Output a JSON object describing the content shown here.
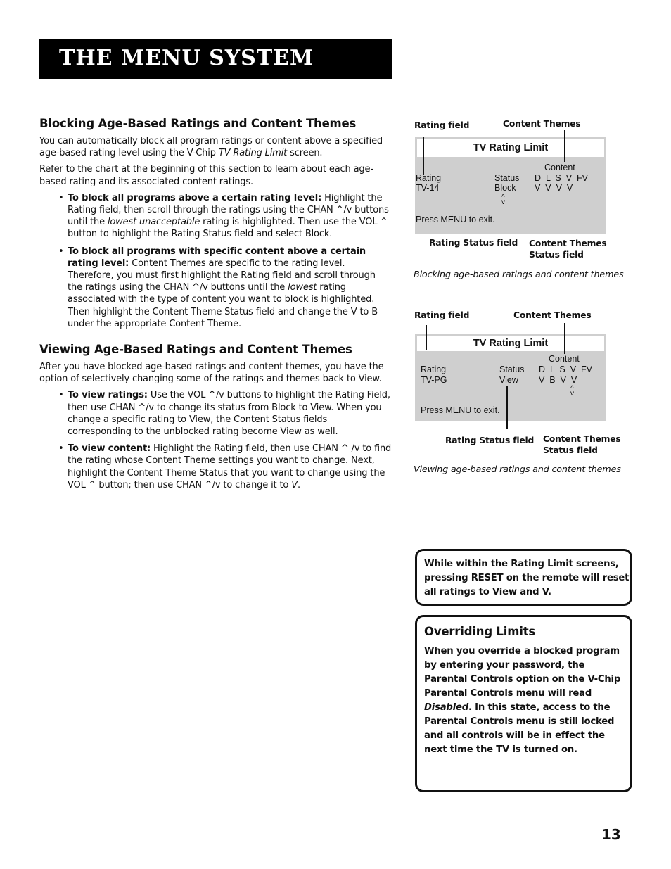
{
  "header": {
    "title": "THE MENU SYSTEM"
  },
  "sections": [
    {
      "heading": "Blocking Age-Based Ratings and Content Themes",
      "paragraphs": [
        {
          "pre": "You can automatically block all program ratings or content above a specified age-based rating level using the V-Chip ",
          "italic": "TV Rating Limit",
          "post": " screen."
        },
        {
          "pre": "Refer to the chart at the beginning of this section to learn about each age-based rating and its associated content ratings.",
          "italic": "",
          "post": ""
        }
      ],
      "bullets": [
        {
          "lead": "To block all programs above a certain rating level:",
          "pre": "   Highlight the Rating field, then scroll through the ratings using the CHAN ^/v buttons until the ",
          "italic": "lowest unacceptable",
          "post": " rating is highlighted. Then use the VOL ^ button to highlight the Rating Status field and select Block."
        },
        {
          "lead": "To block all programs with specific content above a certain rating level:",
          "pre": "   Content Themes are specific to the rating level. Therefore, you must first highlight the Rating field and scroll through the ratings using the CHAN ^/v buttons until the ",
          "italic": "lowest",
          "post": "  rating associated with the type of content you want to block is highlighted. Then highlight the Content Theme Status field and change the V to B under the appropriate Content Theme."
        }
      ]
    },
    {
      "heading": "Viewing Age-Based Ratings and Content Themes",
      "paragraphs": [
        {
          "pre": "After you have blocked age-based ratings and content themes, you have the option of selectively changing some of the ratings and themes back to View.",
          "italic": "",
          "post": ""
        }
      ],
      "bullets": [
        {
          "lead": "To view ratings:",
          "pre": "   Use the VOL ^/v buttons to highlight the Rating Field, then use CHAN ^/v to change its status from Block to View. When you change a specific rating to View, the Content Status fields corresponding to the unblocked rating become View as well.",
          "italic": "",
          "post": ""
        },
        {
          "lead": "To view content:",
          "pre": "   Highlight the Rating field, then use CHAN ^ /v to find the rating whose Content Theme settings you want to change. Next, highlight the Content Theme Status that you want to change using the VOL ^ button; then use CHAN ^/v to change it to ",
          "italic": "V",
          "post": "."
        }
      ]
    }
  ],
  "figures": [
    {
      "callouts": {
        "rating_field": "Rating field",
        "content_themes": "Content Themes",
        "rating_status_field": "Rating Status field",
        "content_status_l1": "Content Themes",
        "content_status_l2": "Status field"
      },
      "screen": {
        "title": "TV Rating Limit",
        "content_label": "Content",
        "rating_label": "Rating",
        "rating_value": "TV-14",
        "status_label": "Status",
        "status_value": "Block",
        "themes_header": "D  L  S  V  FV",
        "themes_values": "V  V  V  V",
        "arrows": "^\nv",
        "exit_hint": "Press MENU to exit."
      },
      "caption": "Blocking age-based ratings and content themes"
    },
    {
      "callouts": {
        "rating_field": "Rating field",
        "content_themes": "Content Themes",
        "rating_status_field": "Rating Status field",
        "content_status_l1": "Content Themes",
        "content_status_l2": "Status field"
      },
      "screen": {
        "title": "TV Rating Limit",
        "content_label": "Content",
        "rating_label": "Rating",
        "rating_value": "TV-PG",
        "status_label": "Status",
        "status_value": "View",
        "themes_header": "D  L  S  V  FV",
        "themes_values": "V  B  V  V",
        "arrows": "^\nv",
        "exit_hint": "Press MENU to exit."
      },
      "caption": "Viewing age-based ratings and content themes"
    }
  ],
  "note": {
    "text": "While within the Rating Limit screens, pressing RESET on the remote will reset all ratings to View and V."
  },
  "override_box": {
    "heading": "Overriding Limits",
    "pre": "When you override a blocked program by entering your password, the Parental Controls option on the V-Chip Parental Controls menu will read  ",
    "italic": "Disabled",
    "post": ". In this state, access to the Parental Controls menu is still locked and all controls will be in effect the next time the TV is turned on."
  },
  "page_number": "13"
}
